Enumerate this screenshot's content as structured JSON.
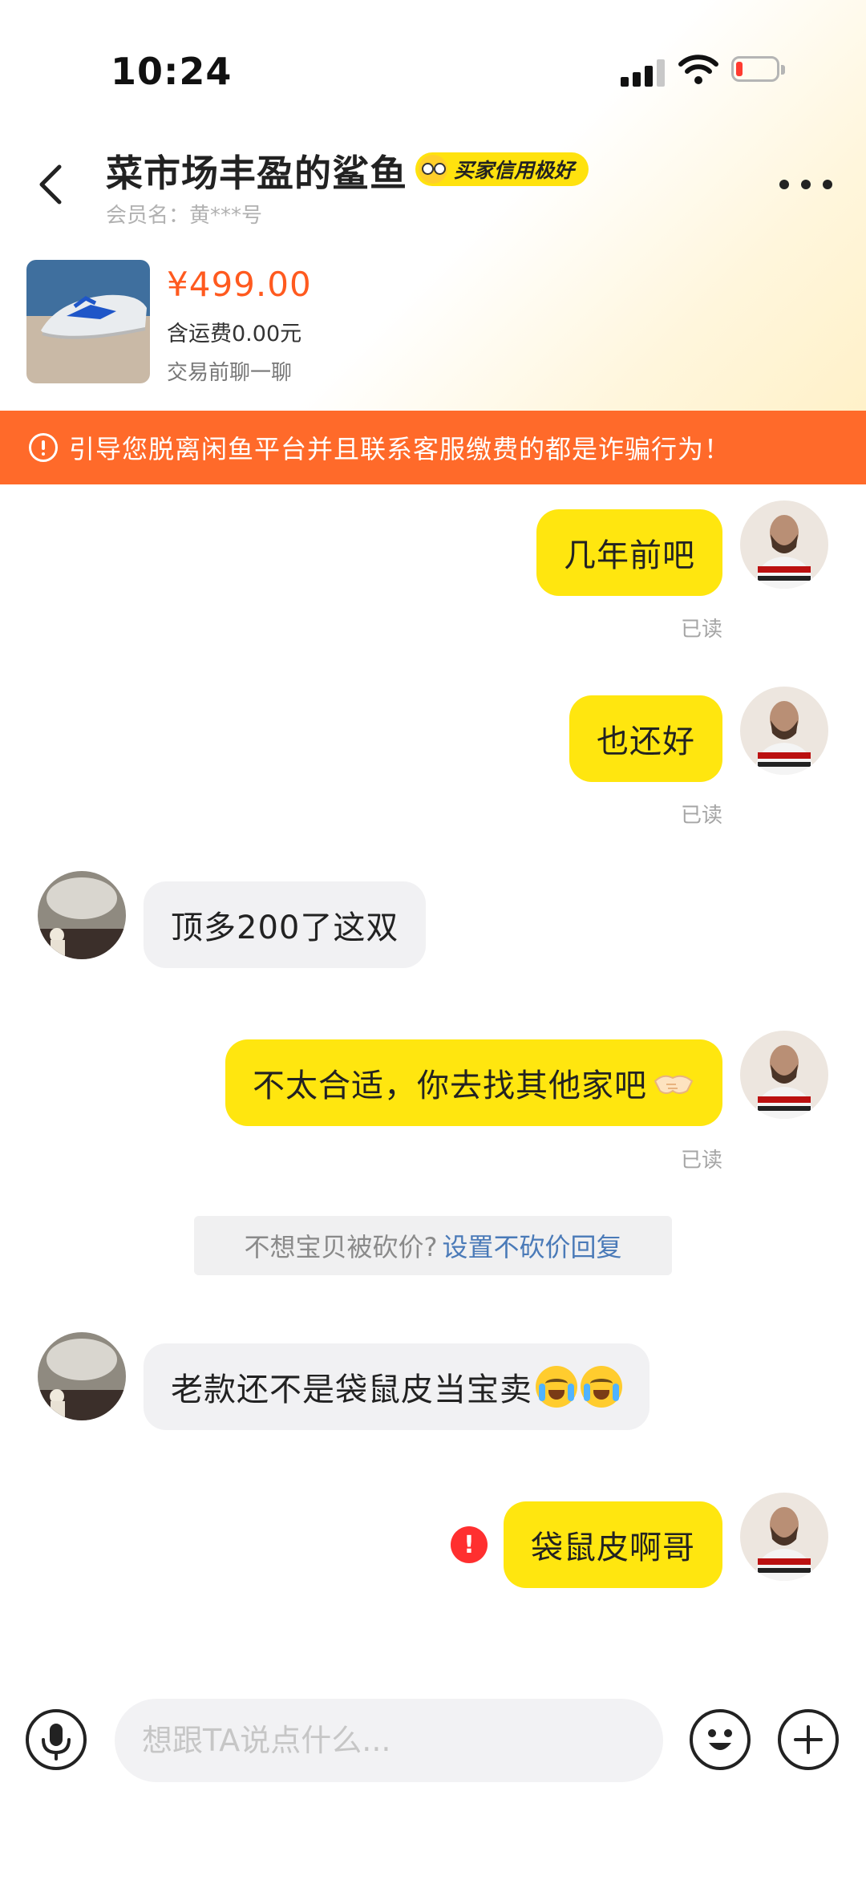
{
  "status_bar": {
    "time": "10:24"
  },
  "header": {
    "title": "菜市场丰盈的鲨鱼",
    "credit_badge": "买家信用极好",
    "member_label": "会员名：黄***号"
  },
  "product": {
    "price": "¥499.00",
    "shipping": "含运费0.00元",
    "note": "交易前聊一聊"
  },
  "warning": {
    "text": "引导您脱离闲鱼平台并且联系客服缴费的都是诈骗行为！"
  },
  "messages": [
    {
      "from": "me",
      "text": "几年前吧",
      "status": "已读"
    },
    {
      "from": "me",
      "text": "也还好",
      "status": "已读"
    },
    {
      "from": "them",
      "text": "顶多200了这双"
    },
    {
      "from": "me",
      "text": "不太合适，你去找其他家吧",
      "status": "已读"
    },
    {
      "from": "them",
      "text": "老款还不是袋鼠皮当宝卖"
    },
    {
      "from": "me",
      "text": "袋鼠皮啊哥",
      "error": "!"
    }
  ],
  "tip": {
    "text": "不想宝贝被砍价?",
    "link": "设置不砍价回复"
  },
  "input": {
    "placeholder": "想跟TA说点什么..."
  },
  "colors": {
    "accent_yellow": "#ffe60f",
    "price_orange": "#ff5a1f",
    "warning_orange": "#ff6a2a",
    "link_blue": "#4a7ab8"
  },
  "icons": {
    "back": "chevron-left-icon",
    "more": "more-dots-icon",
    "mic": "microphone-icon",
    "emoji": "smiley-icon",
    "plus": "plus-icon"
  }
}
